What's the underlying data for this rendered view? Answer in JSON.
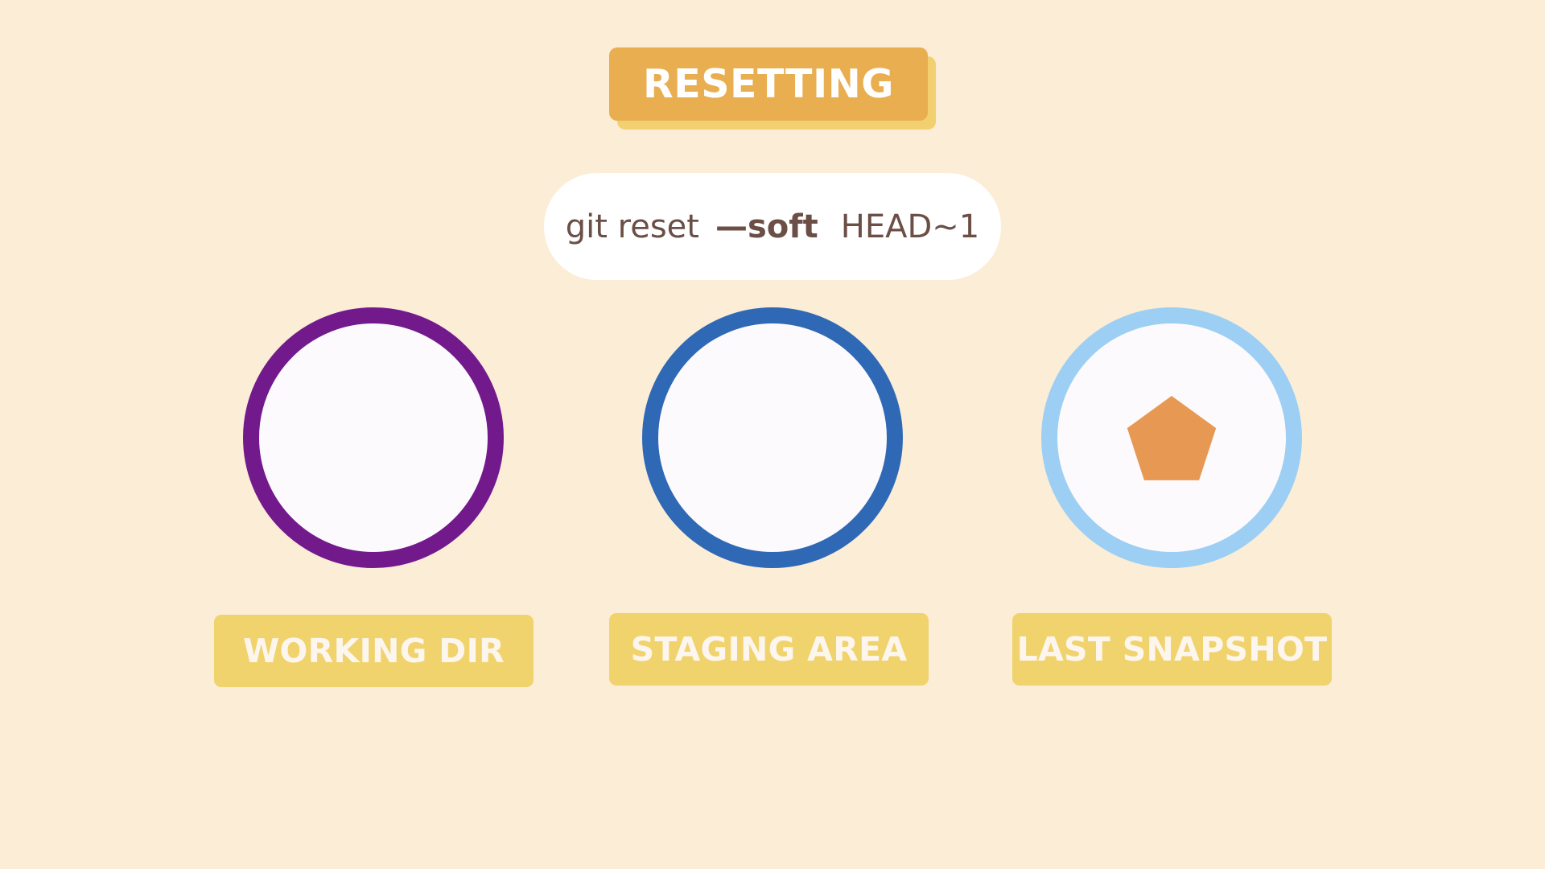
{
  "title": "RESETTING",
  "command": {
    "prefix": "git reset",
    "flag": "—soft",
    "target": "HEAD~1"
  },
  "areas": [
    {
      "label": "WORKING DIR",
      "ring_color": "#721a8c",
      "has_file": false
    },
    {
      "label": "STAGING AREA",
      "ring_color": "#2f69b5",
      "has_file": false
    },
    {
      "label": "LAST SNAPSHOT",
      "ring_color": "#9ccff3",
      "has_file": true,
      "file_icon": "pentagon-icon",
      "file_color": "#e79853"
    }
  ],
  "colors": {
    "background": "#fcedd7",
    "title_bg": "#e9ae50",
    "label_bg": "#f1d36d",
    "command_text": "#6b4f47"
  }
}
